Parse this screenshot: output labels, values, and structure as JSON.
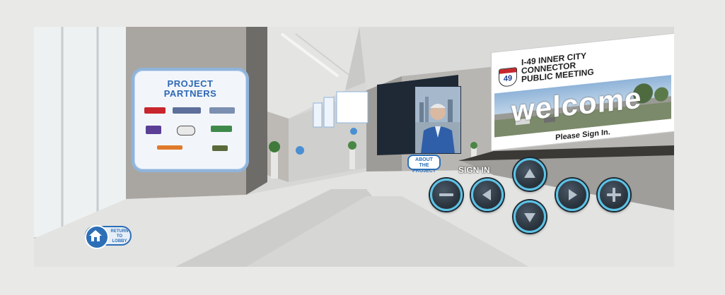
{
  "scene": {
    "partners_title": "PROJECT\nPARTNERS",
    "billboard": {
      "route_number": "49",
      "title": "I-49 INNER CITY\nCONNECTOR\nPUBLIC MEETING",
      "welcome": "welcome",
      "sign_in_prompt": "Please Sign In."
    },
    "about_button": "ABOUT\nTHE PROJECT",
    "sign_in_label": "SIGN IN",
    "return_lobby": "RETURN TO\nLOBBY"
  },
  "navigation": {
    "buttons": [
      "zoom-out",
      "turn-left",
      "move-forward",
      "move-backward",
      "turn-right",
      "zoom-in"
    ]
  },
  "colors": {
    "accent_blue": "#2c6fb6",
    "nav_ring": "#5cc3e6",
    "nav_fill": "#2c3640",
    "route_red": "#c8262d"
  }
}
